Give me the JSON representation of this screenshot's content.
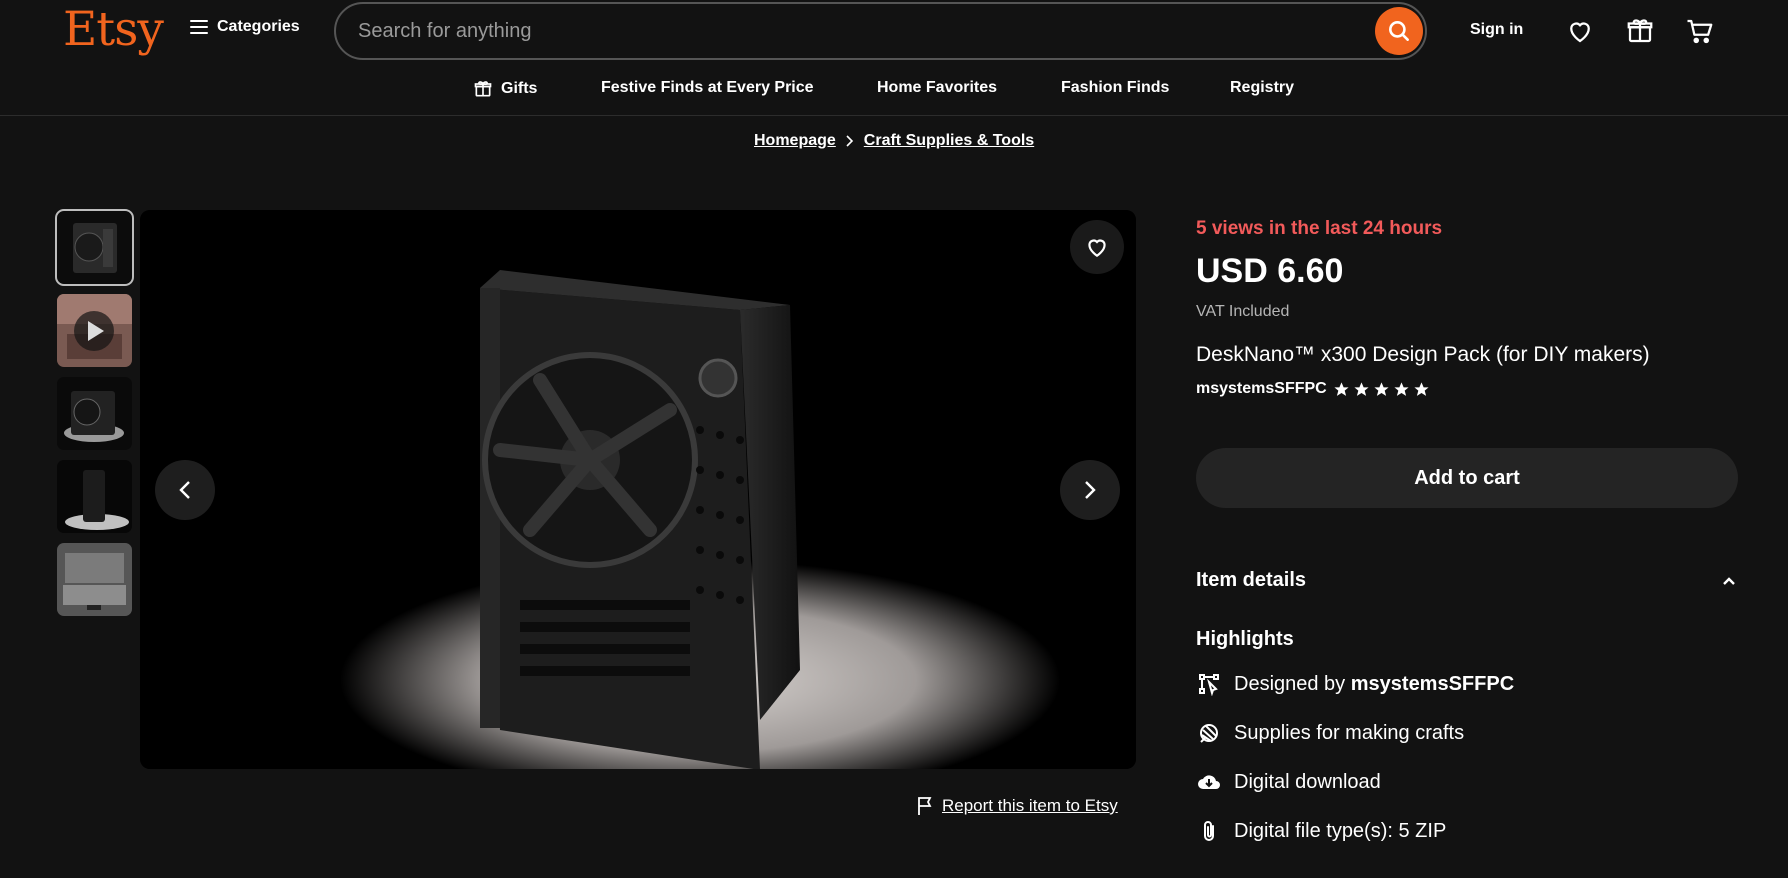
{
  "header": {
    "logo": "Etsy",
    "categories_label": "Categories",
    "search_placeholder": "Search for anything",
    "signin_label": "Sign in"
  },
  "nav": {
    "items": [
      "Gifts",
      "Festive Finds at Every Price",
      "Home Favorites",
      "Fashion Finds",
      "Registry"
    ]
  },
  "breadcrumb": {
    "items": [
      "Homepage",
      "Craft Supplies & Tools"
    ]
  },
  "gallery": {
    "report_label": "Report this item to Etsy"
  },
  "product": {
    "views_text": "5 views in the last 24 hours",
    "price": "USD 6.60",
    "vat": "VAT Included",
    "title": "DeskNano™ x300 Design Pack (for DIY makers)",
    "shop_name": "msystemsSFFPC",
    "rating_stars": 5,
    "add_to_cart": "Add to cart"
  },
  "details": {
    "header": "Item details",
    "highlights_title": "Highlights",
    "designed_prefix": "Designed by",
    "designed_by": "msystemsSFFPC",
    "supplies": "Supplies for making crafts",
    "download": "Digital download",
    "file_type": "Digital file type(s): 5 ZIP"
  },
  "colors": {
    "accent": "#f1641e",
    "views": "#f25a5a",
    "background": "#121212"
  }
}
